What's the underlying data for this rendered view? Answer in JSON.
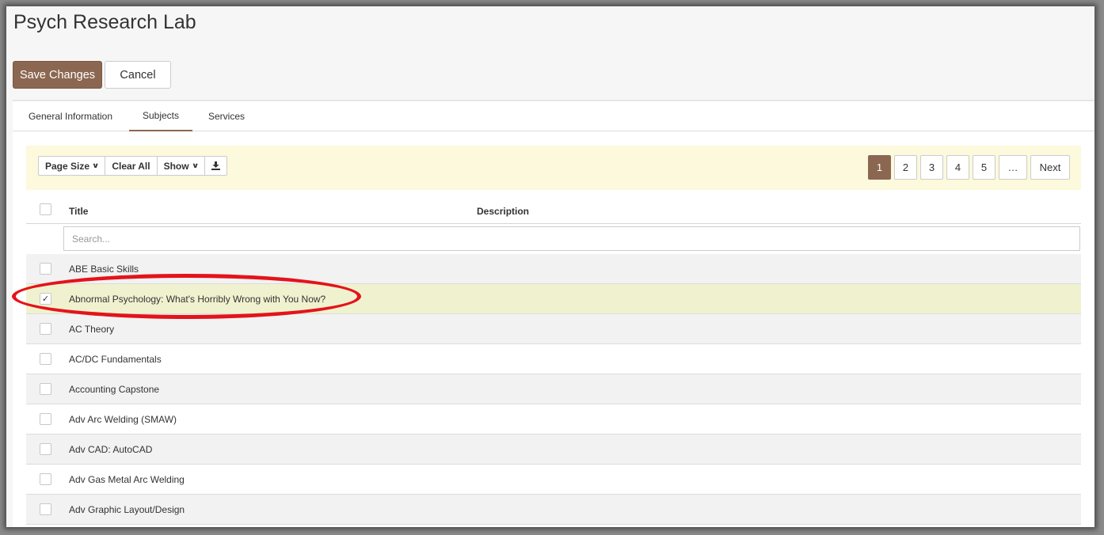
{
  "page": {
    "title": "Psych Research Lab"
  },
  "actions": {
    "save_label": "Save Changes",
    "cancel_label": "Cancel"
  },
  "tabs": [
    {
      "label": "General Information",
      "active": false
    },
    {
      "label": "Subjects",
      "active": true
    },
    {
      "label": "Services",
      "active": false
    }
  ],
  "toolbar": {
    "page_size_label": "Page Size",
    "clear_all_label": "Clear All",
    "show_label": "Show",
    "download_icon": "download-icon"
  },
  "pagination": {
    "pages": [
      "1",
      "2",
      "3",
      "4",
      "5"
    ],
    "current": "1",
    "ellipsis": "…",
    "next_label": "Next"
  },
  "table": {
    "columns": [
      "Title",
      "Description"
    ],
    "search_placeholder": "Search...",
    "rows": [
      {
        "title": "ABE Basic Skills",
        "description": "",
        "checked": false
      },
      {
        "title": "Abnormal Psychology: What's Horribly Wrong with You Now?",
        "description": "",
        "checked": true
      },
      {
        "title": "AC Theory",
        "description": "",
        "checked": false
      },
      {
        "title": "AC/DC Fundamentals",
        "description": "",
        "checked": false
      },
      {
        "title": "Accounting Capstone",
        "description": "",
        "checked": false
      },
      {
        "title": "Adv Arc Welding (SMAW)",
        "description": "",
        "checked": false
      },
      {
        "title": "Adv CAD: AutoCAD",
        "description": "",
        "checked": false
      },
      {
        "title": "Adv Gas Metal Arc Welding",
        "description": "",
        "checked": false
      },
      {
        "title": "Adv Graphic Layout/Design",
        "description": "",
        "checked": false
      }
    ]
  },
  "colors": {
    "accent": "#8b6751",
    "toolbar_bg": "#fcf9dc",
    "selected_row_bg": "#f0f2cf",
    "annotation": "#e4131a"
  }
}
